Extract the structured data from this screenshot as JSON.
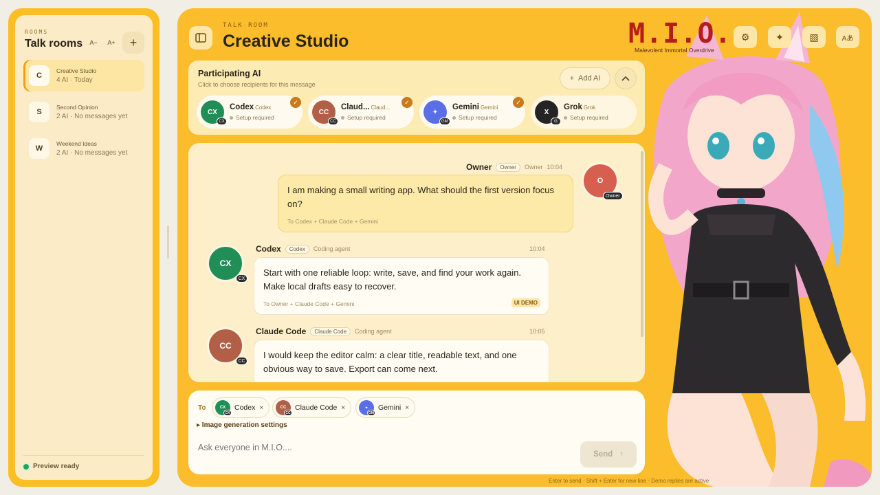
{
  "sidebar": {
    "caption": "ROOMS",
    "title": "Talk rooms",
    "font_smaller": "A−",
    "font_larger": "A+",
    "add_room": "+",
    "rooms": [
      {
        "initial": "C",
        "name": "Creative Studio",
        "meta": "4 AI · Today",
        "active": true
      },
      {
        "initial": "S",
        "name": "Second Opinion",
        "meta": "2 AI · No messages yet",
        "active": false
      },
      {
        "initial": "W",
        "name": "Weekend Ideas",
        "meta": "2 AI · No messages yet",
        "active": false
      }
    ],
    "status": "Preview ready"
  },
  "header": {
    "caption": "TALK ROOM",
    "title": "Creative Studio",
    "logo": "M.I.O.",
    "logo_sub": "Malevolent Immortal Overdrive",
    "buttons": [
      {
        "icon": "gear-icon",
        "glyph": "⚙"
      },
      {
        "icon": "sparkle-icon",
        "glyph": "✦"
      },
      {
        "icon": "texture-icon",
        "glyph": "▧"
      },
      {
        "icon": "language-icon",
        "glyph": "Aあ"
      }
    ]
  },
  "participants": {
    "title": "Participating AI",
    "subtitle": "Click to choose recipients for this message",
    "add_label": "Add AI",
    "chips": [
      {
        "abbr": "CX",
        "name": "Codex",
        "tag": "Codex",
        "status": "Setup required",
        "badge": "CX",
        "selected": true,
        "color": "#1f8f57"
      },
      {
        "abbr": "CC",
        "name": "Claud...",
        "tag": "Claud...",
        "status": "Setup required",
        "badge": "CC",
        "selected": true,
        "color": "#b25f48"
      },
      {
        "abbr": "✦",
        "name": "Gemini",
        "tag": "Gemini",
        "status": "Setup required",
        "badge": "GM",
        "selected": true,
        "color": "#5a6ee8"
      },
      {
        "abbr": "X",
        "name": "Grok",
        "tag": "Grok",
        "status": "Setup required",
        "badge": "G",
        "selected": false,
        "color": "#242424"
      }
    ]
  },
  "messages": [
    {
      "author": "Owner",
      "role_tag": "Owner",
      "role_text": "Owner",
      "time": "10:04",
      "avatar": "O",
      "badge": "Owner",
      "text": "I am making a small writing app. What should the first version focus on?",
      "to": "To Codex + Claude Code + Gemini"
    },
    {
      "author": "Codex",
      "role_tag": "Codex",
      "role_text": "Coding agent",
      "time": "10:04",
      "avatar": "CX",
      "badge": "CX",
      "text": "Start with one reliable loop: write, save, and find your work again. Make local drafts easy to recover.",
      "to": "To Owner + Claude Code + Gemini",
      "tag": "UI DEMO",
      "color": "#1f8f57"
    },
    {
      "author": "Claude Code",
      "role_tag": "Claude Code",
      "role_text": "Coding agent",
      "time": "10:05",
      "avatar": "CC",
      "badge": "CC",
      "text": "I would keep the editor calm: a clear title, readable text, and one obvious way to save. Export can come next.",
      "color": "#b25f48"
    }
  ],
  "composer": {
    "to_label": "To",
    "recipients": [
      {
        "name": "Codex",
        "abbr": "CX",
        "badge": "CX",
        "color": "#1f8f57"
      },
      {
        "name": "Claude Code",
        "abbr": "CC",
        "badge": "CC",
        "color": "#b25f48"
      },
      {
        "name": "Gemini",
        "abbr": "✦",
        "badge": "GM",
        "color": "#5a6ee8"
      }
    ],
    "image_settings": "▸ Image generation settings",
    "placeholder": "Ask everyone in M.I.O....",
    "send_label": "Send",
    "footer": "Enter to send · Shift + Enter for new line · Demo replies are active"
  },
  "colors": {
    "accent": "#fbbd2b",
    "owner": "#d75f4f"
  }
}
